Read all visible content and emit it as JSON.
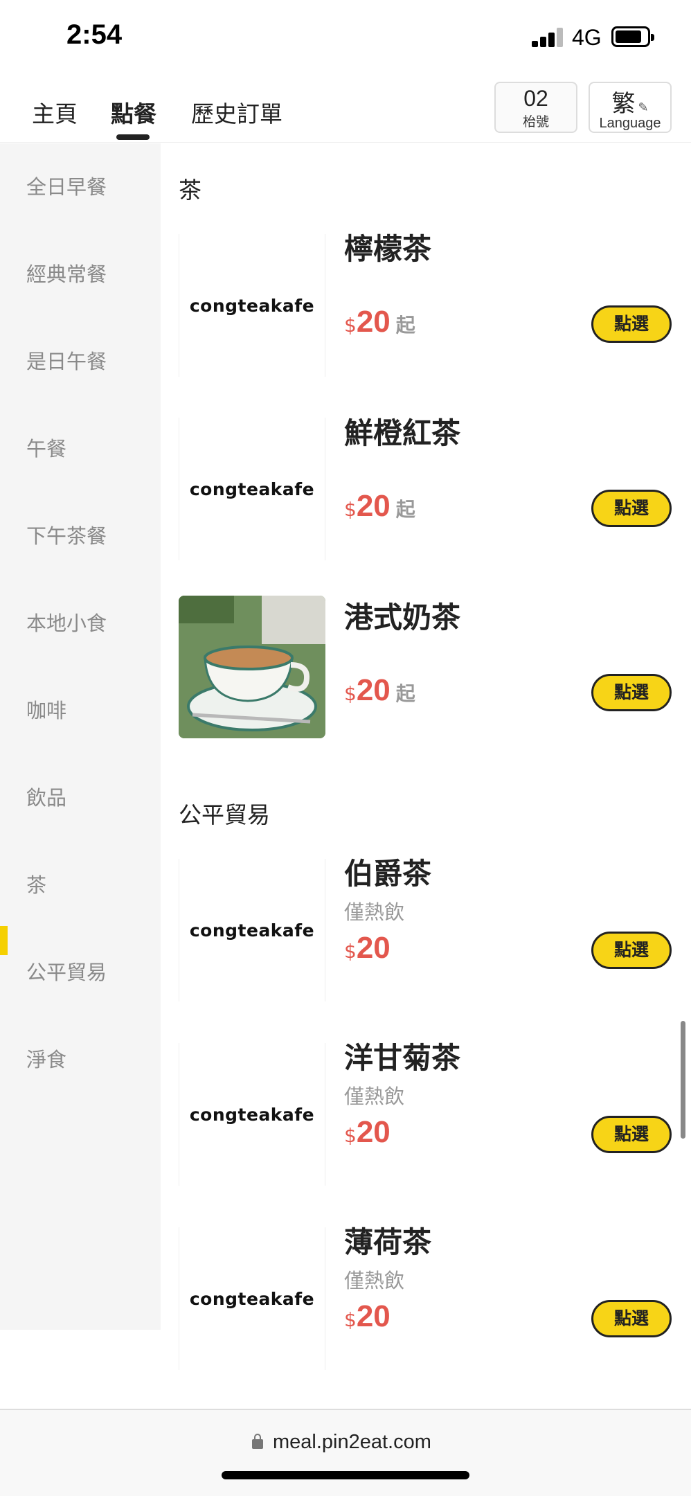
{
  "status_bar": {
    "time": "2:54",
    "network": "4G"
  },
  "nav": {
    "tabs": [
      "主頁",
      "點餐",
      "歷史訂單"
    ],
    "active_tab": "點餐",
    "table_number": "02",
    "table_label": "枱號",
    "lang_char": "繁",
    "lang_label": "Language"
  },
  "sidebar": {
    "items": [
      "全日早餐",
      "經典常餐",
      "是日午餐",
      "午餐",
      "下午茶餐",
      "本地小食",
      "咖啡",
      "飲品",
      "茶",
      "公平貿易",
      "淨食"
    ],
    "active": "飲品"
  },
  "sections": [
    {
      "title": "茶",
      "items": [
        {
          "name": "檸檬茶",
          "desc": "",
          "currency": "$",
          "price": "20",
          "from": "起",
          "image": "logo",
          "logo_text": "congteakafe",
          "button": "點選"
        },
        {
          "name": "鮮橙紅茶",
          "desc": "",
          "currency": "$",
          "price": "20",
          "from": "起",
          "image": "logo",
          "logo_text": "congteakafe",
          "button": "點選"
        },
        {
          "name": "港式奶茶",
          "desc": "",
          "currency": "$",
          "price": "20",
          "from": "起",
          "image": "photo",
          "button": "點選"
        }
      ]
    },
    {
      "title": "公平貿易",
      "items": [
        {
          "name": "伯爵茶",
          "desc": "僅熱飲",
          "currency": "$",
          "price": "20",
          "from": "",
          "image": "logo",
          "logo_text": "congteakafe",
          "button": "點選"
        },
        {
          "name": "洋甘菊茶",
          "desc": "僅熱飲",
          "currency": "$",
          "price": "20",
          "from": "",
          "image": "logo",
          "logo_text": "congteakafe",
          "button": "點選"
        },
        {
          "name": "薄荷茶",
          "desc": "僅熱飲",
          "currency": "$",
          "price": "20",
          "from": "",
          "image": "logo",
          "logo_text": "congteakafe",
          "button": "點選"
        }
      ]
    }
  ],
  "url_bar": {
    "url": "meal.pin2eat.com"
  },
  "colors": {
    "accent": "#f7d417",
    "price": "#e3574d",
    "sidebar_bg": "#f5f5f5"
  }
}
